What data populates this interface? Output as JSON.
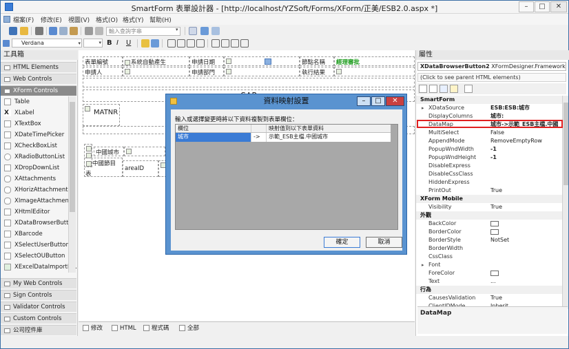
{
  "window": {
    "title": "SmartForm 表單設計器 - [http://localhost/YZSoft/Forms/XForm/正美/ESB2.0.aspx *]"
  },
  "menu": [
    "檔案(F)",
    "修改(E)",
    "視圖(V)",
    "格式(O)",
    "格式(Y)",
    "幫助(H)"
  ],
  "toolbar": {
    "search_placeholder": "輸入查詢字串",
    "font_name": "Verdana"
  },
  "toolbox": {
    "title": "工具箱",
    "top_groups": [
      "HTML Elements",
      "Web Controls",
      "XForm Controls"
    ],
    "items": [
      "Table",
      "XLabel",
      "XTextBox",
      "XDateTimePicker",
      "XCheckBoxList",
      "XRadioButtonList",
      "XDropDownList",
      "XAttachments",
      "XHorizAttachments",
      "XImageAttachment",
      "XHtmlEditor",
      "XDataBrowserButton",
      "XBarcode",
      "XSelectUserButton",
      "XSelectOUButton",
      "XExcelDataImportB..."
    ],
    "bottom_groups": [
      "My Web Controls",
      "Sign Controls",
      "Validator Controls",
      "Custom Controls",
      "公司控件庫"
    ]
  },
  "form": {
    "label_form_no": "表單編號",
    "value_auto": "系統自動產生",
    "label_apply_date": "申請日期",
    "label_sign_name": "節點名稱",
    "value_manager_approve": "經理審批",
    "label_applicant": "申請人",
    "label_apply_dept": "申請部門",
    "label_exec_result": "執行結果",
    "sap": "SAP",
    "matnr": "MATNR",
    "china_city": "中國城市",
    "china_node": "中國節目",
    "table_label": "表",
    "area_id": "areaID"
  },
  "bottom_tabs": [
    "修改",
    "HTML",
    "程式碼",
    "全部"
  ],
  "dialog": {
    "title": "資料映射設置",
    "prompt": "輸入或選擇變更時將以下資料複製到表單欄位：",
    "columns": [
      "欄位",
      "映射值到以下表單資料"
    ],
    "rows": [
      {
        "field": "城市",
        "arrow": "->",
        "target": "示範_ESB主檔.中國城市"
      }
    ],
    "ok": "確定",
    "cancel": "取消"
  },
  "properties": {
    "title": "屬性",
    "object_name": "XDataBrowserButton2",
    "object_type": "XFormDesigner.Framework.We",
    "parent_link": "(Click to see parent HTML elements)",
    "rows": [
      {
        "type": "cat",
        "name": "SmartForm"
      },
      {
        "type": "prop",
        "name": "XDataSource",
        "value": "ESB:ESB:城市",
        "bold": true,
        "expand": true
      },
      {
        "type": "prop",
        "name": "DisplayColumns",
        "value": "城市:",
        "bold": true
      },
      {
        "type": "prop",
        "name": "DataMap",
        "value": "城市->示範_ESB主檔.中國",
        "bold": true
      },
      {
        "type": "prop",
        "name": "MultiSelect",
        "value": "False"
      },
      {
        "type": "prop",
        "name": "AppendMode",
        "value": "RemoveEmptyRow"
      },
      {
        "type": "prop",
        "name": "PopupWndWidth",
        "value": "-1",
        "bold": true
      },
      {
        "type": "prop",
        "name": "PopupWndHeight",
        "value": "-1",
        "bold": true
      },
      {
        "type": "prop",
        "name": "DisableExpress",
        "value": ""
      },
      {
        "type": "prop",
        "name": "DisableCssClass",
        "value": ""
      },
      {
        "type": "prop",
        "name": "HiddenExpress",
        "value": ""
      },
      {
        "type": "prop",
        "name": "PrintOut",
        "value": "True"
      },
      {
        "type": "cat",
        "name": "XForm Mobile"
      },
      {
        "type": "prop",
        "name": "Visibility",
        "value": "True"
      },
      {
        "type": "cat",
        "name": "外觀"
      },
      {
        "type": "prop",
        "name": "BackColor",
        "value": "",
        "swatch": true
      },
      {
        "type": "prop",
        "name": "BorderColor",
        "value": "",
        "swatch": true
      },
      {
        "type": "prop",
        "name": "BorderStyle",
        "value": "NotSet"
      },
      {
        "type": "prop",
        "name": "BorderWidth",
        "value": ""
      },
      {
        "type": "prop",
        "name": "CssClass",
        "value": ""
      },
      {
        "type": "prop",
        "name": "Font",
        "value": "",
        "expand": true
      },
      {
        "type": "prop",
        "name": "ForeColor",
        "value": "",
        "swatch": true
      },
      {
        "type": "prop",
        "name": "Text",
        "value": "..."
      },
      {
        "type": "cat",
        "name": "行為"
      },
      {
        "type": "prop",
        "name": "CausesValidation",
        "value": "True"
      },
      {
        "type": "prop",
        "name": "ClientIDMode",
        "value": "Inherit"
      }
    ],
    "description_title": "DataMap"
  }
}
